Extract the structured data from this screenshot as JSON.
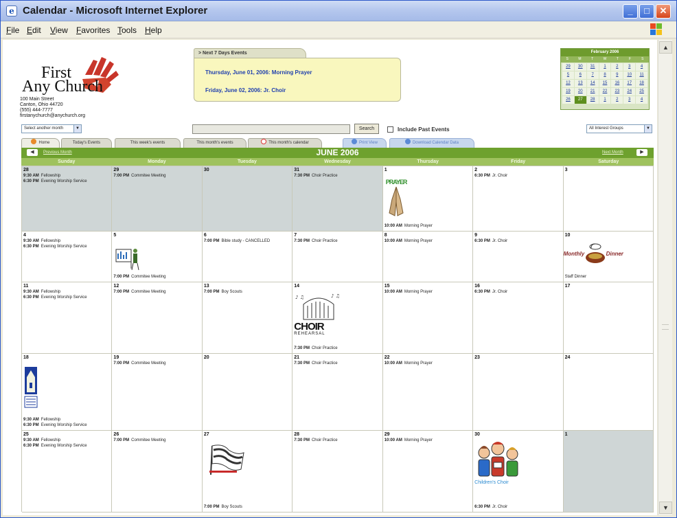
{
  "window": {
    "title": "Calendar - Microsoft Internet Explorer",
    "minimize": "_",
    "maximize": "□",
    "close": "✕"
  },
  "menu": [
    "File",
    "Edit",
    "View",
    "Favorites",
    "Tools",
    "Help"
  ],
  "church": {
    "name_line1": "First",
    "name_line2": "Any Church",
    "address": [
      "100 Main Street",
      "Canton, Ohio 44720",
      "(555) 444-7777",
      "firstanychurch@anychurch.org"
    ]
  },
  "next_events": {
    "tab_label": "Next 7 Days Events",
    "items": [
      "Thursday, June 01, 2006: Morning Prayer",
      "Friday, June 02, 2006: Jr. Choir"
    ]
  },
  "mini_calendar": {
    "title": "February 2006",
    "days_of_week": [
      "S",
      "M",
      "T",
      "W",
      "T",
      "F",
      "S"
    ],
    "dates": [
      "29",
      "30",
      "31",
      "1",
      "2",
      "3",
      "4",
      "5",
      "6",
      "7",
      "8",
      "9",
      "10",
      "11",
      "12",
      "13",
      "14",
      "15",
      "16",
      "17",
      "18",
      "19",
      "20",
      "21",
      "22",
      "23",
      "24",
      "25",
      "26",
      "27",
      "28",
      "1",
      "2",
      "3",
      "4"
    ],
    "today_index": 29
  },
  "controls": {
    "select_month": "Select another month",
    "search_button": "Search",
    "include_past": "Include Past Events",
    "groups": "All Interest Groups"
  },
  "tabs": [
    "Home",
    "Today's Events",
    "This week's events",
    "This month's events",
    "This month's calendar",
    "Print View",
    "Download Calendar Data"
  ],
  "calendar": {
    "month_title": "JUNE 2006",
    "prev_label": "Previous Month",
    "next_label": "Next Month",
    "prev_arrow": "◀",
    "next_arrow": "▶",
    "days_of_week": [
      "Sunday",
      "Monday",
      "Tuesday",
      "Wednesday",
      "Thursday",
      "Friday",
      "Saturday"
    ],
    "cells": [
      {
        "day": "28",
        "other": true,
        "events": [
          {
            "time": "9:30 AM",
            "title": "Fellowship"
          },
          {
            "time": "6:30 PM",
            "title": "Evening Worship Service"
          }
        ]
      },
      {
        "day": "29",
        "other": true,
        "events": [
          {
            "time": "7:00 PM",
            "title": "Commitee Meeting"
          }
        ]
      },
      {
        "day": "30",
        "other": true,
        "events": []
      },
      {
        "day": "31",
        "other": true,
        "events": [
          {
            "time": "7:30 PM",
            "title": "Choir Practice"
          }
        ]
      },
      {
        "day": "1",
        "other": false,
        "clip": "PRAYER",
        "events": [
          {
            "time": "10:00 AM",
            "title": "Morning Prayer"
          }
        ]
      },
      {
        "day": "2",
        "other": false,
        "events": [
          {
            "time": "6:30 PM",
            "title": "Jr. Choir"
          }
        ]
      },
      {
        "day": "3",
        "other": false,
        "events": []
      },
      {
        "day": "4",
        "other": false,
        "events": [
          {
            "time": "9:30 AM",
            "title": "Fellowship"
          },
          {
            "time": "6:30 PM",
            "title": "Evening Worship Service"
          }
        ]
      },
      {
        "day": "5",
        "other": false,
        "clip": "meeting",
        "events": [
          {
            "time": "7:00 PM",
            "title": "Commitee Meeting"
          }
        ]
      },
      {
        "day": "6",
        "other": false,
        "events": [
          {
            "time": "7:00 PM",
            "title": "Bible study - CANCELLED"
          }
        ]
      },
      {
        "day": "7",
        "other": false,
        "events": [
          {
            "time": "7:30 PM",
            "title": "Choir Practice"
          }
        ]
      },
      {
        "day": "8",
        "other": false,
        "events": [
          {
            "time": "10:00 AM",
            "title": "Morning Prayer"
          }
        ]
      },
      {
        "day": "9",
        "other": false,
        "events": [
          {
            "time": "6:30 PM",
            "title": "Jr. Choir"
          }
        ]
      },
      {
        "day": "10",
        "other": false,
        "clip": "dinner",
        "events": [
          {
            "time": "",
            "title": "Staff Dinner"
          }
        ]
      },
      {
        "day": "11",
        "other": false,
        "events": [
          {
            "time": "9:30 AM",
            "title": "Fellowship"
          },
          {
            "time": "6:30 PM",
            "title": "Evening Worship Service"
          }
        ]
      },
      {
        "day": "12",
        "other": false,
        "events": [
          {
            "time": "7:00 PM",
            "title": "Commitee Meeting"
          }
        ]
      },
      {
        "day": "13",
        "other": false,
        "events": [
          {
            "time": "7:00 PM",
            "title": "Boy Scouts"
          }
        ]
      },
      {
        "day": "14",
        "other": false,
        "clip": "choir",
        "events": [
          {
            "time": "7:30 PM",
            "title": "Choir Practice"
          }
        ]
      },
      {
        "day": "15",
        "other": false,
        "events": [
          {
            "time": "10:00 AM",
            "title": "Morning Prayer"
          }
        ]
      },
      {
        "day": "16",
        "other": false,
        "events": [
          {
            "time": "6:30 PM",
            "title": "Jr. Choir"
          }
        ]
      },
      {
        "day": "17",
        "other": false,
        "events": []
      },
      {
        "day": "18",
        "other": false,
        "clip": "church",
        "events": [
          {
            "time": "9:30 AM",
            "title": "Fellowship"
          },
          {
            "time": "6:30 PM",
            "title": "Evening Worship Service"
          }
        ]
      },
      {
        "day": "19",
        "other": false,
        "events": [
          {
            "time": "7:00 PM",
            "title": "Commitee Meeting"
          }
        ]
      },
      {
        "day": "20",
        "other": false,
        "events": []
      },
      {
        "day": "21",
        "other": false,
        "events": [
          {
            "time": "7:30 PM",
            "title": "Choir Practice"
          }
        ]
      },
      {
        "day": "22",
        "other": false,
        "events": [
          {
            "time": "10:00 AM",
            "title": "Morning Prayer"
          }
        ]
      },
      {
        "day": "23",
        "other": false,
        "events": []
      },
      {
        "day": "24",
        "other": false,
        "events": []
      },
      {
        "day": "25",
        "other": false,
        "events": [
          {
            "time": "9:30 AM",
            "title": "Fellowship"
          },
          {
            "time": "6:30 PM",
            "title": "Evening Worship Service"
          }
        ]
      },
      {
        "day": "26",
        "other": false,
        "events": [
          {
            "time": "7:00 PM",
            "title": "Commitee Meeting"
          }
        ]
      },
      {
        "day": "27",
        "other": false,
        "clip": "scouts",
        "events": [
          {
            "time": "7:00 PM",
            "title": "Boy Scouts"
          }
        ]
      },
      {
        "day": "28",
        "other": false,
        "events": [
          {
            "time": "7:30 PM",
            "title": "Choir Practice"
          }
        ]
      },
      {
        "day": "29",
        "other": false,
        "events": [
          {
            "time": "10:00 AM",
            "title": "Morning Prayer"
          }
        ]
      },
      {
        "day": "30",
        "other": false,
        "clip": "kids",
        "events": [
          {
            "time": "6:30 PM",
            "title": "Jr. Choir"
          }
        ]
      },
      {
        "day": "1",
        "other": true,
        "events": []
      }
    ]
  },
  "clip_text": {
    "prayer": "PRAYER",
    "monthly": "Monthly",
    "dinner": "Dinner",
    "choir": "CHOIR",
    "rehearsal": "REHEARSAL",
    "childrens_choir": "Children's Choir"
  },
  "colors": {
    "accent_green": "#6ea12e",
    "link_blue": "#1f3fae",
    "events_box": "#f9f7be"
  }
}
